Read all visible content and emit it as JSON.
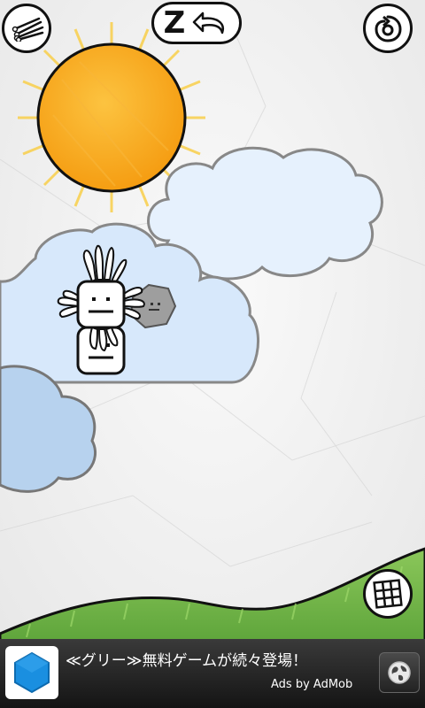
{
  "hud": {
    "undo_letter": "Z",
    "menu_icon": "matches-menu-icon",
    "restart_icon": "restart-spiral-icon",
    "undo_icon": "undo-arrow-icon",
    "level_grid_icon": "level-grid-icon"
  },
  "ad": {
    "title": "≪グリー≫無料ゲームが続々登場！",
    "attribution": "Ads by AdMob",
    "app_icon": "hexagon-icon",
    "globe_icon": "globe-icon"
  },
  "colors": {
    "sun": "#f7a91e",
    "cloud_blue": "#d7e8fb",
    "cloud_pale": "#e6f1fd",
    "grass": "#5fa83a",
    "ad_bar": "#1e1e1e"
  }
}
